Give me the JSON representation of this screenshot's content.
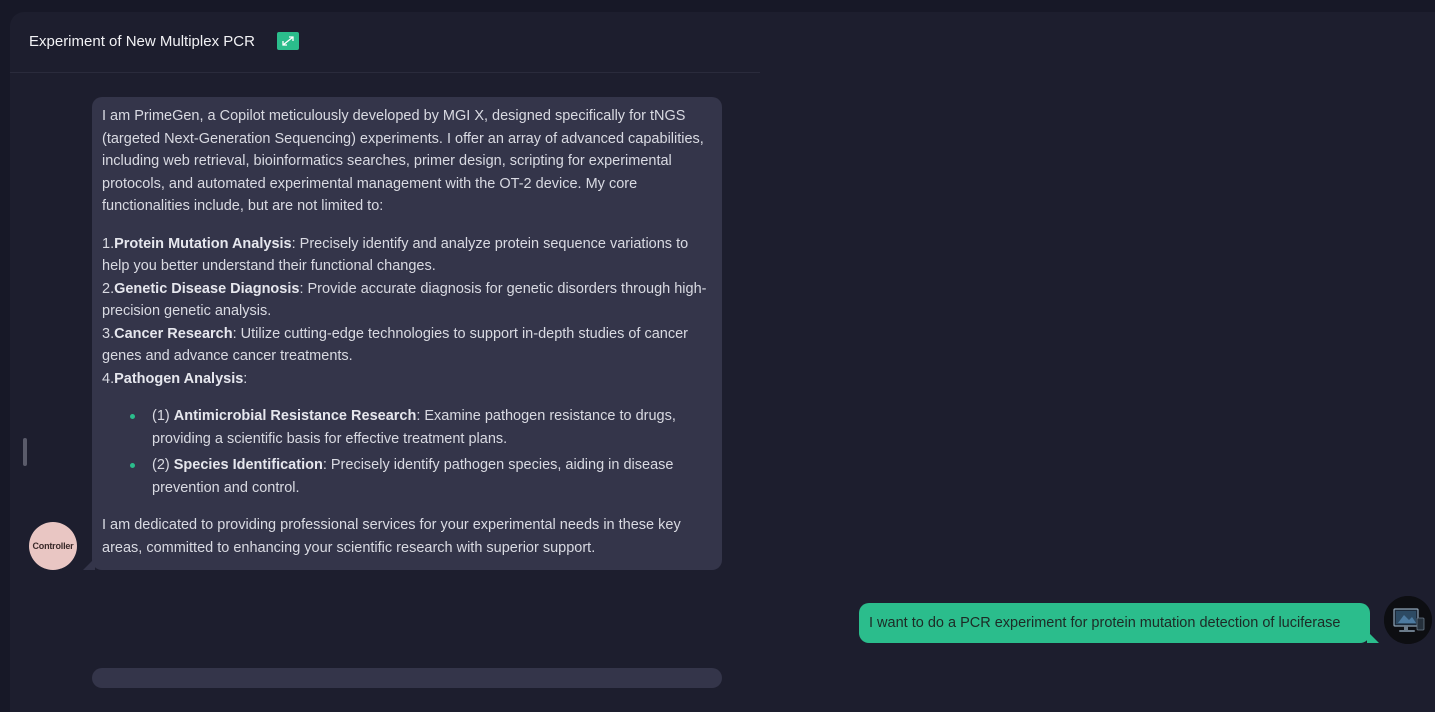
{
  "header": {
    "title": "Experiment of New Multiplex PCR"
  },
  "bot_message": {
    "intro": "I am PrimeGen, a Copilot meticulously developed by MGI X, designed specifically for tNGS (targeted Next-Generation Sequencing) experiments. I offer an array of advanced capabilities, including web retrieval, bioinformatics searches, primer design, scripting for experimental protocols, and automated experimental management with the OT-2 device. My core functionalities include, but are not limited to:",
    "items": [
      {
        "num": "1.",
        "title": "Protein Mutation Analysis",
        "text": ": Precisely identify and analyze protein sequence variations to help you better understand their functional changes."
      },
      {
        "num": "2.",
        "title": "Genetic Disease Diagnosis",
        "text": ": Provide accurate diagnosis for genetic disorders through high-precision genetic analysis."
      },
      {
        "num": "3.",
        "title": "Cancer Research",
        "text": ": Utilize cutting-edge technologies to support in-depth studies of cancer genes and advance cancer treatments."
      },
      {
        "num": "4.",
        "title": "Pathogen Analysis",
        "text": ":"
      }
    ],
    "sub_items": [
      {
        "prefix": "(1) ",
        "title": "Antimicrobial Resistance Research",
        "text": ": Examine pathogen resistance to drugs, providing a scientific basis for effective treatment plans."
      },
      {
        "prefix": "(2) ",
        "title": "Species Identification",
        "text": ": Precisely identify pathogen species, aiding in disease prevention and control."
      }
    ],
    "closing": "I am dedicated to providing professional services for your experimental needs in these key areas, committed to enhancing your scientific research with superior support."
  },
  "controller_avatar": {
    "label": "Controller"
  },
  "user_message": {
    "text": "I want to do a PCR experiment for protein mutation detection of luciferase"
  },
  "icons": {
    "expand": "expand-arrows-icon",
    "user_avatar": "monitor-avatar-icon"
  },
  "colors": {
    "accent": "#2bbd8c",
    "background": "#1d1e2e",
    "bubble": "#34354a"
  }
}
